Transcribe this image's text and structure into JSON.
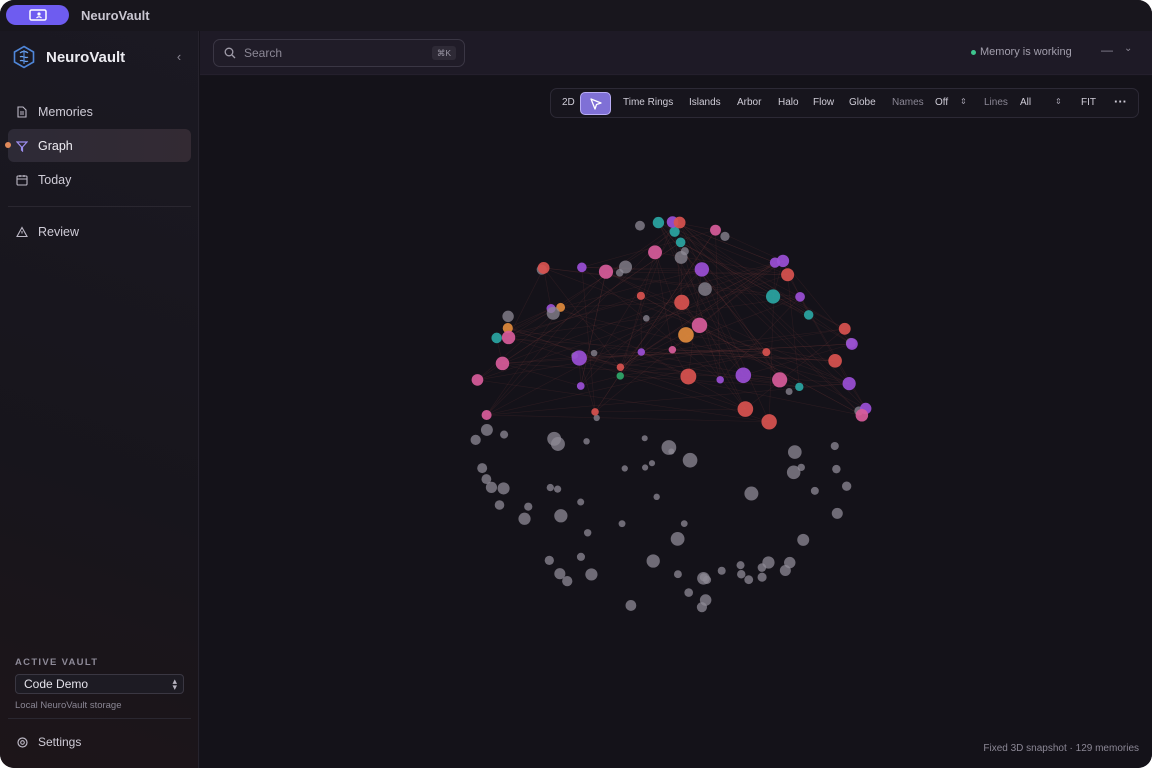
{
  "app": {
    "title": "NeuroVault",
    "brand": "NeuroVault"
  },
  "sidebar": {
    "items": [
      {
        "label": "Memories",
        "icon": "document-icon"
      },
      {
        "label": "Graph",
        "icon": "graph-icon",
        "active": true
      },
      {
        "label": "Today",
        "icon": "calendar-icon"
      },
      {
        "label": "Review",
        "icon": "warning-icon"
      }
    ],
    "active_vault_label": "ACTIVE VAULT",
    "vault_selected": "Code Demo",
    "vault_note": "Local NeuroVault storage",
    "settings_label": "Settings"
  },
  "header": {
    "search_placeholder": "Search",
    "shortcut": "⌘K",
    "status": "Memory is working"
  },
  "toolbar": {
    "mode_2d": "2D",
    "layouts": [
      "Time Rings",
      "Islands",
      "Arbor",
      "Halo",
      "Flow",
      "Globe"
    ],
    "names_label": "Names",
    "names_value": "Off",
    "lines_label": "Lines",
    "lines_value": "All",
    "fit": "FIT",
    "more": "···"
  },
  "footer": {
    "note": "Fixed 3D snapshot · 129 memories"
  },
  "colors": {
    "accent": "#6e5cf0",
    "red": "#d9534f",
    "purple": "#9b4fd6",
    "orange": "#e08a3c",
    "green": "#2fa86a",
    "teal": "#2aa6a3",
    "pink": "#d85c9a",
    "gray": "#8d8a96",
    "status_green": "#3ec58e"
  }
}
